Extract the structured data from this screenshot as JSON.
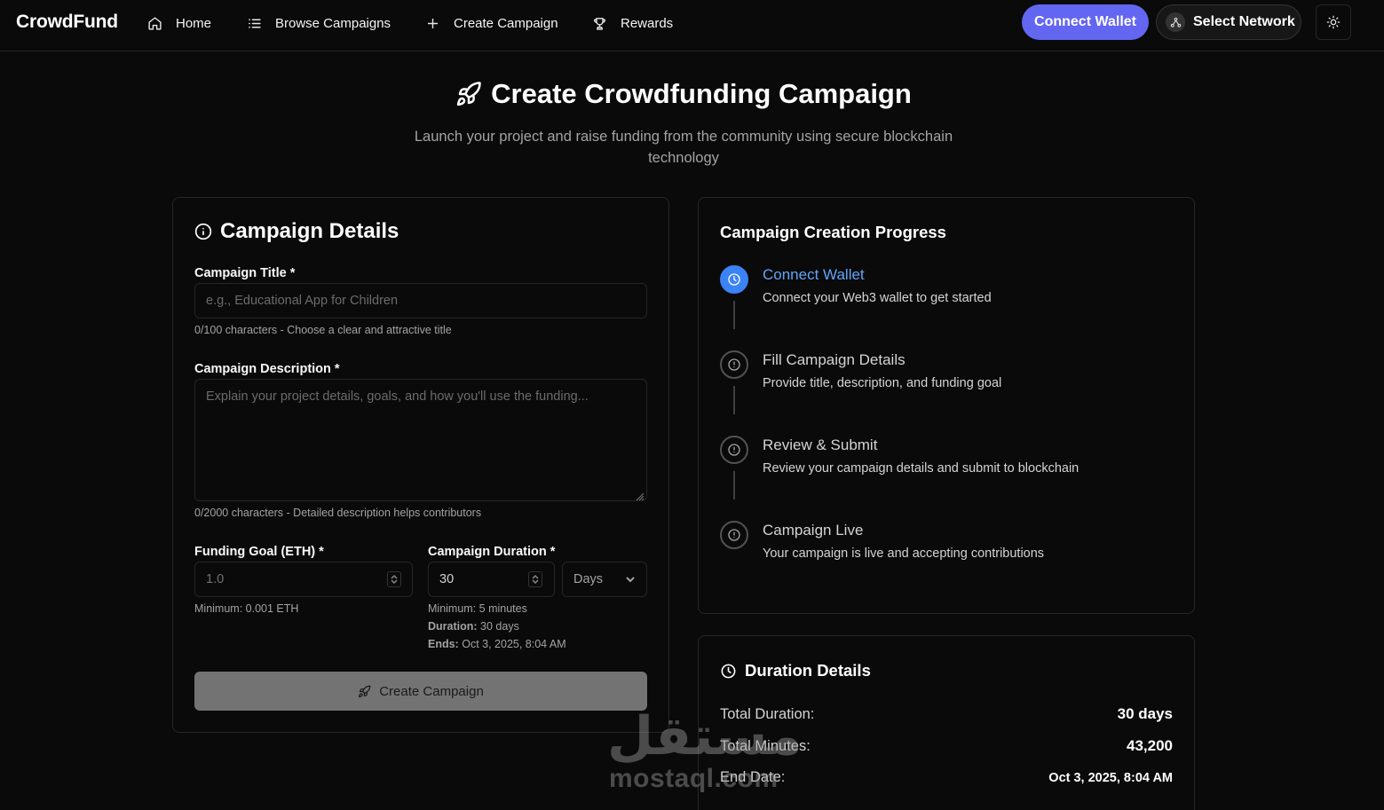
{
  "nav": {
    "brand": "CrowdFund",
    "items": [
      {
        "label": "Home",
        "icon": "home-icon"
      },
      {
        "label": "Browse Campaigns",
        "icon": "list-icon"
      },
      {
        "label": "Create Campaign",
        "icon": "plus-icon"
      },
      {
        "label": "Rewards",
        "icon": "trophy-icon"
      }
    ],
    "connect_wallet": "Connect Wallet",
    "select_network": "Select Network"
  },
  "hero": {
    "title": "Create Crowdfunding Campaign",
    "subtitle": "Launch your project and raise funding from the community using secure blockchain technology"
  },
  "form": {
    "heading": "Campaign Details",
    "title_label": "Campaign Title *",
    "title_placeholder": "e.g., Educational App for Children",
    "title_hint": "0/100 characters - Choose a clear and attractive title",
    "desc_label": "Campaign Description *",
    "desc_placeholder": "Explain your project details, goals, and how you'll use the funding...",
    "desc_hint": "0/2000 characters - Detailed description helps contributors",
    "goal_label": "Funding Goal (ETH) *",
    "goal_value": "1.0",
    "goal_hint": "Minimum: 0.001 ETH",
    "duration_label": "Campaign Duration *",
    "duration_value": "30",
    "duration_unit": "Days",
    "duration_min": "Minimum: 5 minutes",
    "duration_key": "Duration:",
    "duration_text": "30 days",
    "ends_key": "Ends:",
    "ends_text": "Oct 3, 2025, 8:04 AM",
    "submit": "Create Campaign"
  },
  "progress": {
    "heading": "Campaign Creation Progress",
    "steps": [
      {
        "title": "Connect Wallet",
        "desc": "Connect your Web3 wallet to get started",
        "active": true
      },
      {
        "title": "Fill Campaign Details",
        "desc": "Provide title, description, and funding goal",
        "active": false
      },
      {
        "title": "Review & Submit",
        "desc": "Review your campaign details and submit to blockchain",
        "active": false
      },
      {
        "title": "Campaign Live",
        "desc": "Your campaign is live and accepting contributions",
        "active": false
      }
    ]
  },
  "duration": {
    "heading": "Duration Details",
    "rows": [
      {
        "key": "Total Duration:",
        "value": "30 days"
      },
      {
        "key": "Total Minutes:",
        "value": "43,200"
      },
      {
        "key": "End Date:",
        "value": "Oct 3, 2025, 8:04 AM"
      }
    ]
  },
  "watermark": {
    "arabic": "مستقل",
    "latin": "mostaql.com"
  },
  "colors": {
    "accent": "#6366f1",
    "active_step": "#3b82f6",
    "background": "#0a0a0a"
  }
}
